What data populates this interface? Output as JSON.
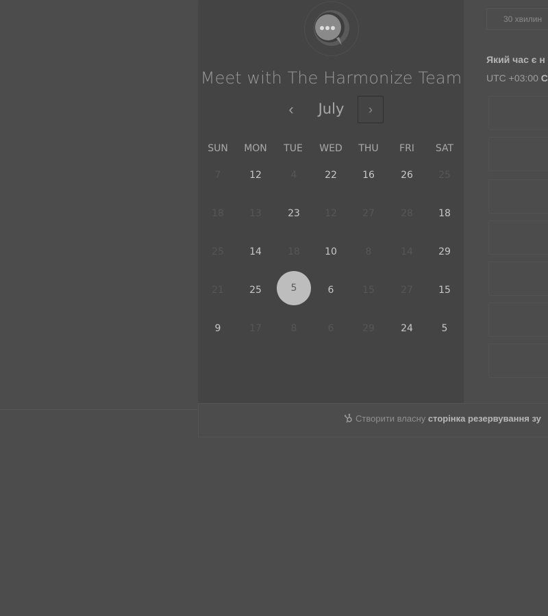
{
  "booking": {
    "title": "Meet with The Harmonize Team",
    "month": "July",
    "prev_icon": "‹",
    "next_icon": "›",
    "weekdays": [
      "SUN",
      "MON",
      "TUE",
      "WED",
      "THU",
      "FRI",
      "SAT"
    ],
    "weeks": [
      [
        {
          "d": "7",
          "on": false
        },
        {
          "d": "12",
          "on": true
        },
        {
          "d": "4",
          "on": false
        },
        {
          "d": "22",
          "on": true
        },
        {
          "d": "16",
          "on": true
        },
        {
          "d": "26",
          "on": true
        },
        {
          "d": "25",
          "on": false
        }
      ],
      [
        {
          "d": "18",
          "on": false
        },
        {
          "d": "13",
          "on": false
        },
        {
          "d": "23",
          "on": true
        },
        {
          "d": "12",
          "on": false
        },
        {
          "d": "27",
          "on": false
        },
        {
          "d": "28",
          "on": false
        },
        {
          "d": "18",
          "on": true
        }
      ],
      [
        {
          "d": "25",
          "on": false
        },
        {
          "d": "14",
          "on": true
        },
        {
          "d": "18",
          "on": false
        },
        {
          "d": "10",
          "on": true
        },
        {
          "d": "8",
          "on": false
        },
        {
          "d": "14",
          "on": false
        },
        {
          "d": "29",
          "on": true
        }
      ],
      [
        {
          "d": "21",
          "on": false
        },
        {
          "d": "25",
          "on": true
        },
        {
          "d": "5",
          "on": true,
          "selected": true
        },
        {
          "d": "6",
          "on": true
        },
        {
          "d": "15",
          "on": false
        },
        {
          "d": "27",
          "on": false
        },
        {
          "d": "15",
          "on": true
        }
      ],
      [
        {
          "d": "9",
          "on": true
        },
        {
          "d": "17",
          "on": false
        },
        {
          "d": "8",
          "on": false
        },
        {
          "d": "6",
          "on": false
        },
        {
          "d": "29",
          "on": false
        },
        {
          "d": "24",
          "on": true
        },
        {
          "d": "5",
          "on": true
        }
      ]
    ]
  },
  "times": {
    "duration_label": "30 хвилин",
    "question": "Який час є н",
    "timezone_prefix": "UTC +03:00",
    "timezone_bold": "С",
    "slot_count": 7
  },
  "footer": {
    "prefix": "Створити власну",
    "link": "сторінка резервування зу"
  },
  "colors": {
    "overlay_background": "#4c4c4c",
    "panel_background": "#444444",
    "selected_day": "#bdbdbd"
  },
  "icons": {
    "logo": "chat-bubble-logo-icon",
    "footer": "hubspot-sprocket-icon"
  }
}
